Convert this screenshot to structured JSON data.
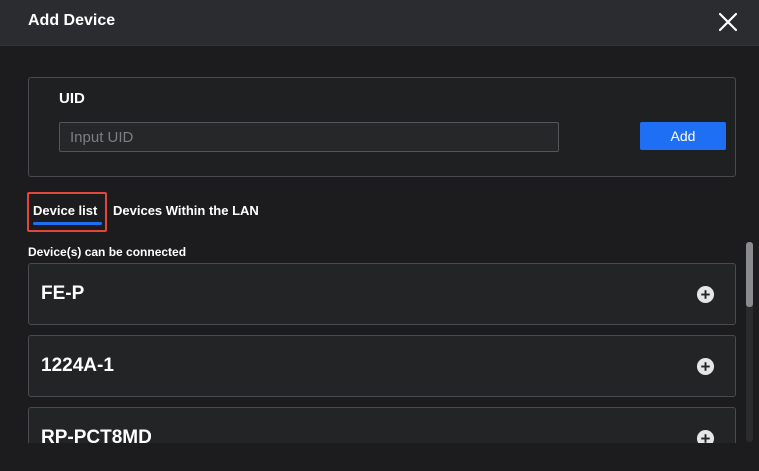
{
  "dialog": {
    "title": "Add Device",
    "close_icon": "close-icon"
  },
  "uid_section": {
    "label": "UID",
    "input_value": "",
    "input_placeholder": "Input UID",
    "add_button_label": "Add"
  },
  "tabs": [
    {
      "label": "Device list",
      "active": true
    },
    {
      "label": "Devices Within the LAN",
      "active": false
    }
  ],
  "device_list": {
    "section_label": "Device(s) can be connected",
    "items": [
      {
        "name": "FE-P",
        "action_icon": "plus-circle-icon"
      },
      {
        "name": "1224A-1",
        "action_icon": "plus-circle-icon"
      },
      {
        "name": "RP-PCT8MD",
        "action_icon": "plus-circle-icon"
      }
    ]
  },
  "colors": {
    "accent": "#1f6ff5",
    "highlight": "#e0463a",
    "background": "#1c1c1e",
    "titlebar": "#2b2c2f"
  }
}
